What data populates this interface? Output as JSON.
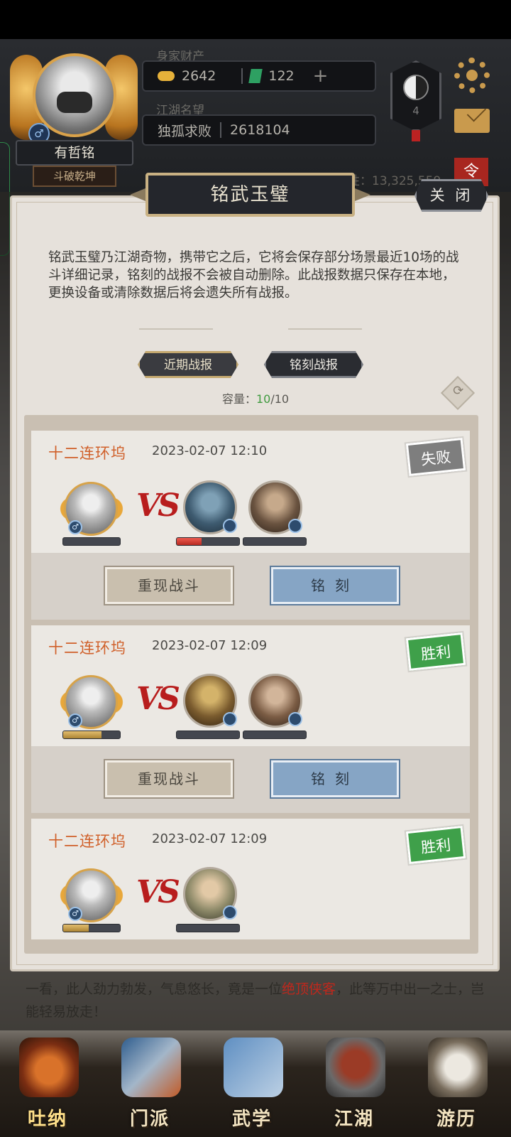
{
  "header": {
    "player_name": "有哲铭",
    "player_title": "斗破乾坤",
    "gender_symbol": "♂",
    "wealth_label": "身家财产",
    "gold": "2642",
    "jade": "122",
    "plus_label": "+",
    "fame_label": "江湖名望",
    "fame_title": "独孤求败",
    "fame_value": "2618104",
    "taiji_level": "4",
    "power_text": "性：13,325,559",
    "corner_text": "令"
  },
  "modal": {
    "title": "铭武玉璧",
    "close_label": "关 闭",
    "description": "铭武玉璧乃江湖奇物，携带它之后，它将会保存部分场景最近10场的战斗详细记录，铭刻的战报不会被自动删除。此战报数据只保存在本地，更换设备或清除数据后将会遗失所有战报。",
    "tabs": [
      {
        "label": "近期战报",
        "active": true
      },
      {
        "label": "铭刻战报",
        "active": false
      }
    ],
    "capacity_label": "容量：",
    "capacity_used": "10",
    "capacity_total": "/10"
  },
  "records": [
    {
      "scene": "十二连环坞",
      "time": "2023-02-07 12:10",
      "result": "失败",
      "player_hp": 0.0,
      "enemy_hp": [
        0.4,
        0.0
      ],
      "replay_label": "重现战斗",
      "engrave_label": "铭刻"
    },
    {
      "scene": "十二连环坞",
      "time": "2023-02-07 12:09",
      "result": "胜利",
      "player_hp": 0.68,
      "enemy_hp": [
        0.0,
        0.0
      ],
      "replay_label": "重现战斗",
      "engrave_label": "铭刻"
    },
    {
      "scene": "十二连环坞",
      "time": "2023-02-07 12:09",
      "result": "胜利",
      "player_hp": 0.45,
      "enemy_hp": [
        0.0
      ]
    }
  ],
  "vs_text": "VS",
  "story": {
    "before": "一看，此人劲力勃发，气息悠长，竟是一位",
    "highlight": "绝顶侠客",
    "after": "，此等万中出一之士，岂能轻易放走！"
  },
  "nav": [
    {
      "label": "吐纳",
      "icon": "incense-burner-icon",
      "active": true
    },
    {
      "label": "门派",
      "icon": "sect-flag-icon",
      "active": false
    },
    {
      "label": "武学",
      "icon": "martial-books-icon",
      "active": false
    },
    {
      "label": "江湖",
      "icon": "bamboo-hat-icon",
      "active": false
    },
    {
      "label": "游历",
      "icon": "white-horse-icon",
      "active": false
    }
  ]
}
